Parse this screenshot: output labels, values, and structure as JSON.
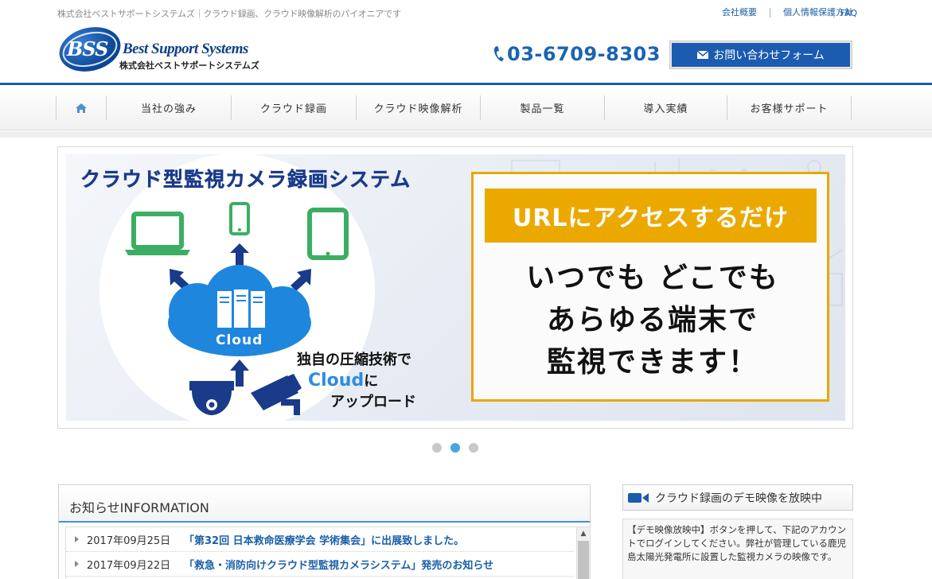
{
  "header": {
    "tagline": "株式会社ベストサポートシステムズ｜クラウド録画、クラウド映像解析のパイオニアです",
    "top_links": [
      "会社概要",
      "個人情報保護方針",
      "FAQ"
    ],
    "logo": {
      "mark": "BSS",
      "name_en": "Best Support Systems",
      "name_jp": "株式会社ベストサポートシステムズ"
    },
    "phone": "03-6709-8303",
    "contact_button": "お問い合わせフォーム",
    "colors": {
      "brand_blue": "#1a5fa8",
      "button_blue": "#1b5bb0"
    }
  },
  "nav": {
    "home_icon": "home-icon",
    "items": [
      "当社の強み",
      "クラウド録画",
      "クラウド映像解析",
      "製品一覧",
      "導入実績",
      "お客様サポート"
    ]
  },
  "hero": {
    "title": "クラウド型監視カメラ録画システム",
    "cloud_label": "Cloud",
    "compress_line1": "独自の圧縮技術で",
    "compress_cloud": "Cloud",
    "compress_ni": "に",
    "compress_line3": "アップロード",
    "panel_head": "URLにアクセスするだけ",
    "panel_lines": [
      "いつでも どこでも",
      "あらゆる端末で",
      "監視できます！"
    ],
    "colors": {
      "accent_orange": "#eba900",
      "title_navy": "#1a3a8a",
      "cloud_blue": "#1f86de",
      "device_green": "#3cae63"
    }
  },
  "slider": {
    "count": 3,
    "active": 2
  },
  "info": {
    "heading": "お知らせINFORMATION",
    "items": [
      {
        "date": "2017年09月25日",
        "title": "「第32回 日本救命医療学会 学術集会」に出展致しました。"
      },
      {
        "date": "2017年09月22日",
        "title": "「救急・消防向けクラウド型監視カメラシステム」発売のお知らせ"
      }
    ]
  },
  "demo": {
    "heading": "クラウド録画のデモ映像を放映中",
    "text": "【デモ映像放映中】ボタンを押して、下記のアカウントでログインしてください。弊社が管理している鹿児島太陽光発電所に設置した監視カメラの映像です。"
  }
}
